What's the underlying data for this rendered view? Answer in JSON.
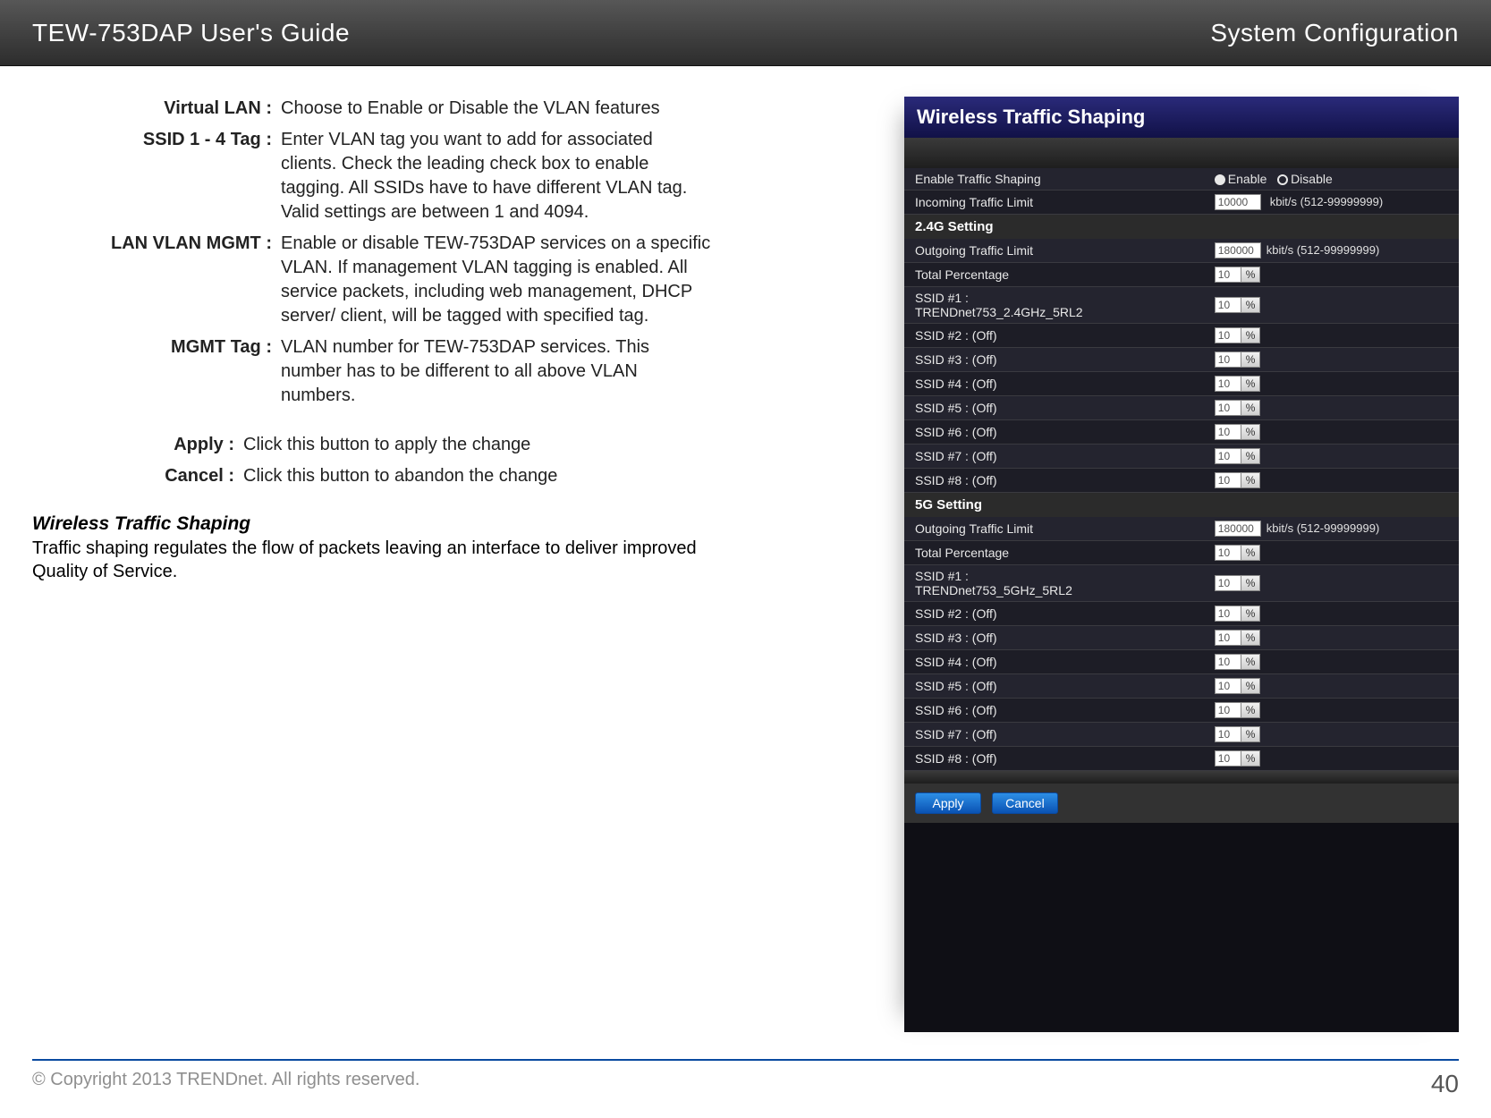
{
  "header": {
    "left": "TEW-753DAP User's Guide",
    "right": "System Configuration"
  },
  "definitions": [
    {
      "label": "Virtual LAN :",
      "text": "Choose to Enable or Disable the VLAN features"
    },
    {
      "label": "SSID 1 - 4 Tag :",
      "text": "Enter VLAN tag you want to add for associated clients. Check the leading check box to enable tagging. All SSIDs have to have different VLAN tag. Valid settings are between 1 and 4094."
    },
    {
      "label": "LAN VLAN MGMT :",
      "text": "Enable or disable TEW-753DAP services on a specific VLAN. If management VLAN tagging is enabled. All service packets, including web management, DHCP server/ client, will be tagged with specified tag."
    },
    {
      "label": "MGMT Tag :",
      "text": "VLAN number for TEW-753DAP services. This number has to be different to all above VLAN numbers."
    }
  ],
  "actions": [
    {
      "label": "Apply :",
      "text": "Click this button to apply the change"
    },
    {
      "label": "Cancel :",
      "text": "Click this button to abandon the change"
    }
  ],
  "subsection": {
    "heading": "Wireless Traffic Shaping",
    "body": "Traffic shaping regulates the flow of packets leaving an interface to deliver improved Quality of Service."
  },
  "panel": {
    "title": "Wireless Traffic Shaping",
    "enable_row": {
      "label": "Enable Traffic Shaping",
      "opt_enable": "Enable",
      "opt_disable": "Disable"
    },
    "incoming_row": {
      "label": "Incoming Traffic Limit",
      "value": "10000",
      "unit": "kbit/s (512-99999999)"
    },
    "bands": [
      {
        "name": "2.4G Setting",
        "outgoing": {
          "label": "Outgoing Traffic Limit",
          "value": "180000",
          "unit": "kbit/s (512-99999999)"
        },
        "total": {
          "label": "Total Percentage",
          "value": "10"
        },
        "ssids": [
          {
            "label": "SSID #1 : TRENDnet753_2.4GHz_5RL2",
            "value": "10",
            "wrap": true
          },
          {
            "label": "SSID #2 : (Off)",
            "value": "10"
          },
          {
            "label": "SSID #3 : (Off)",
            "value": "10"
          },
          {
            "label": "SSID #4 : (Off)",
            "value": "10"
          },
          {
            "label": "SSID #5 : (Off)",
            "value": "10"
          },
          {
            "label": "SSID #6 : (Off)",
            "value": "10"
          },
          {
            "label": "SSID #7 : (Off)",
            "value": "10"
          },
          {
            "label": "SSID #8 : (Off)",
            "value": "10"
          }
        ]
      },
      {
        "name": "5G Setting",
        "outgoing": {
          "label": "Outgoing Traffic Limit",
          "value": "180000",
          "unit": "kbit/s (512-99999999)"
        },
        "total": {
          "label": "Total Percentage",
          "value": "10"
        },
        "ssids": [
          {
            "label": "SSID #1 : TRENDnet753_5GHz_5RL2",
            "value": "10",
            "wrap": true
          },
          {
            "label": "SSID #2 : (Off)",
            "value": "10"
          },
          {
            "label": "SSID #3 : (Off)",
            "value": "10"
          },
          {
            "label": "SSID #4 : (Off)",
            "value": "10"
          },
          {
            "label": "SSID #5 : (Off)",
            "value": "10"
          },
          {
            "label": "SSID #6 : (Off)",
            "value": "10"
          },
          {
            "label": "SSID #7 : (Off)",
            "value": "10"
          },
          {
            "label": "SSID #8 : (Off)",
            "value": "10"
          }
        ]
      }
    ],
    "buttons": {
      "apply": "Apply",
      "cancel": "Cancel"
    }
  },
  "footer": {
    "copyright": "© Copyright 2013 TRENDnet. All rights reserved.",
    "page": "40"
  }
}
